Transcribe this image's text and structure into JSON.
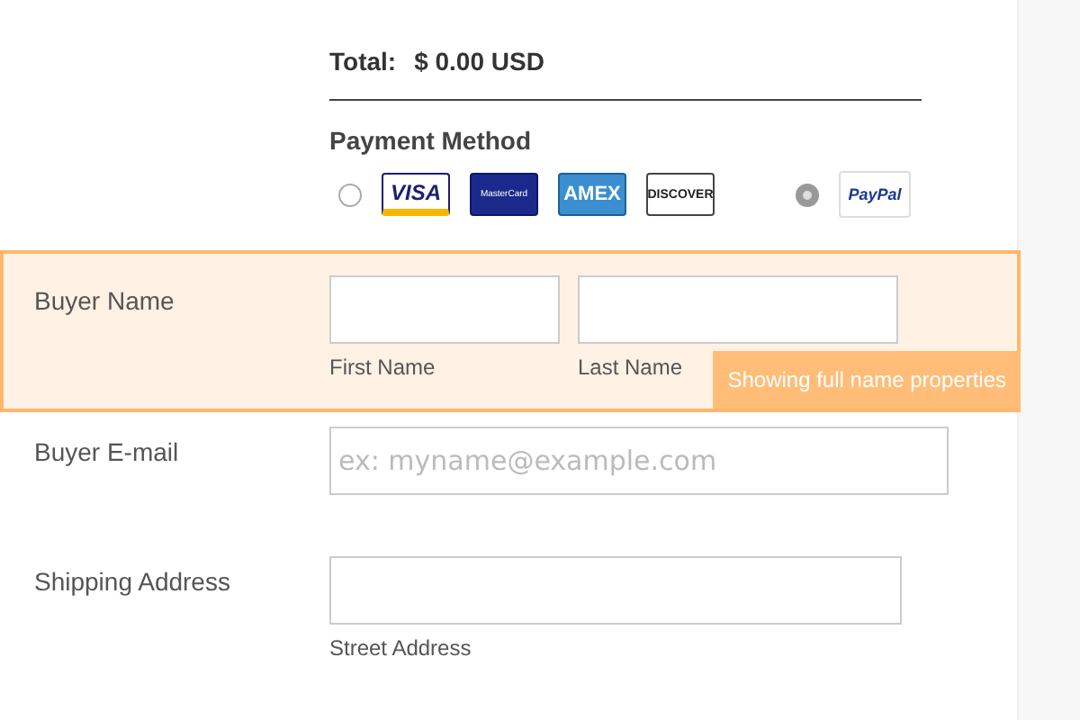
{
  "total": {
    "label": "Total:",
    "amount": "$ 0.00 USD"
  },
  "payment": {
    "title": "Payment Method",
    "options": [
      {
        "selected": false,
        "cards": [
          {
            "kind": "visa",
            "text": "VISA"
          },
          {
            "kind": "mastercard",
            "text": "MasterCard"
          },
          {
            "kind": "amex",
            "text": "AMEX"
          },
          {
            "kind": "discover",
            "text": "DISCOVER"
          }
        ]
      },
      {
        "selected": true,
        "cards": [
          {
            "kind": "paypal",
            "text": "PayPal"
          }
        ]
      }
    ]
  },
  "fields": [
    {
      "kind": "name",
      "label": "Buyer Name",
      "highlighted": true,
      "sublabels": [
        "First Name",
        "Last Name"
      ],
      "tooltip": "Showing full name properties"
    },
    {
      "kind": "email",
      "label": "Buyer E-mail",
      "highlighted": false,
      "placeholder": "ex: myname@example.com"
    },
    {
      "kind": "address",
      "label": "Shipping Address",
      "highlighted": false,
      "sublabels": [
        "Street Address"
      ]
    }
  ]
}
